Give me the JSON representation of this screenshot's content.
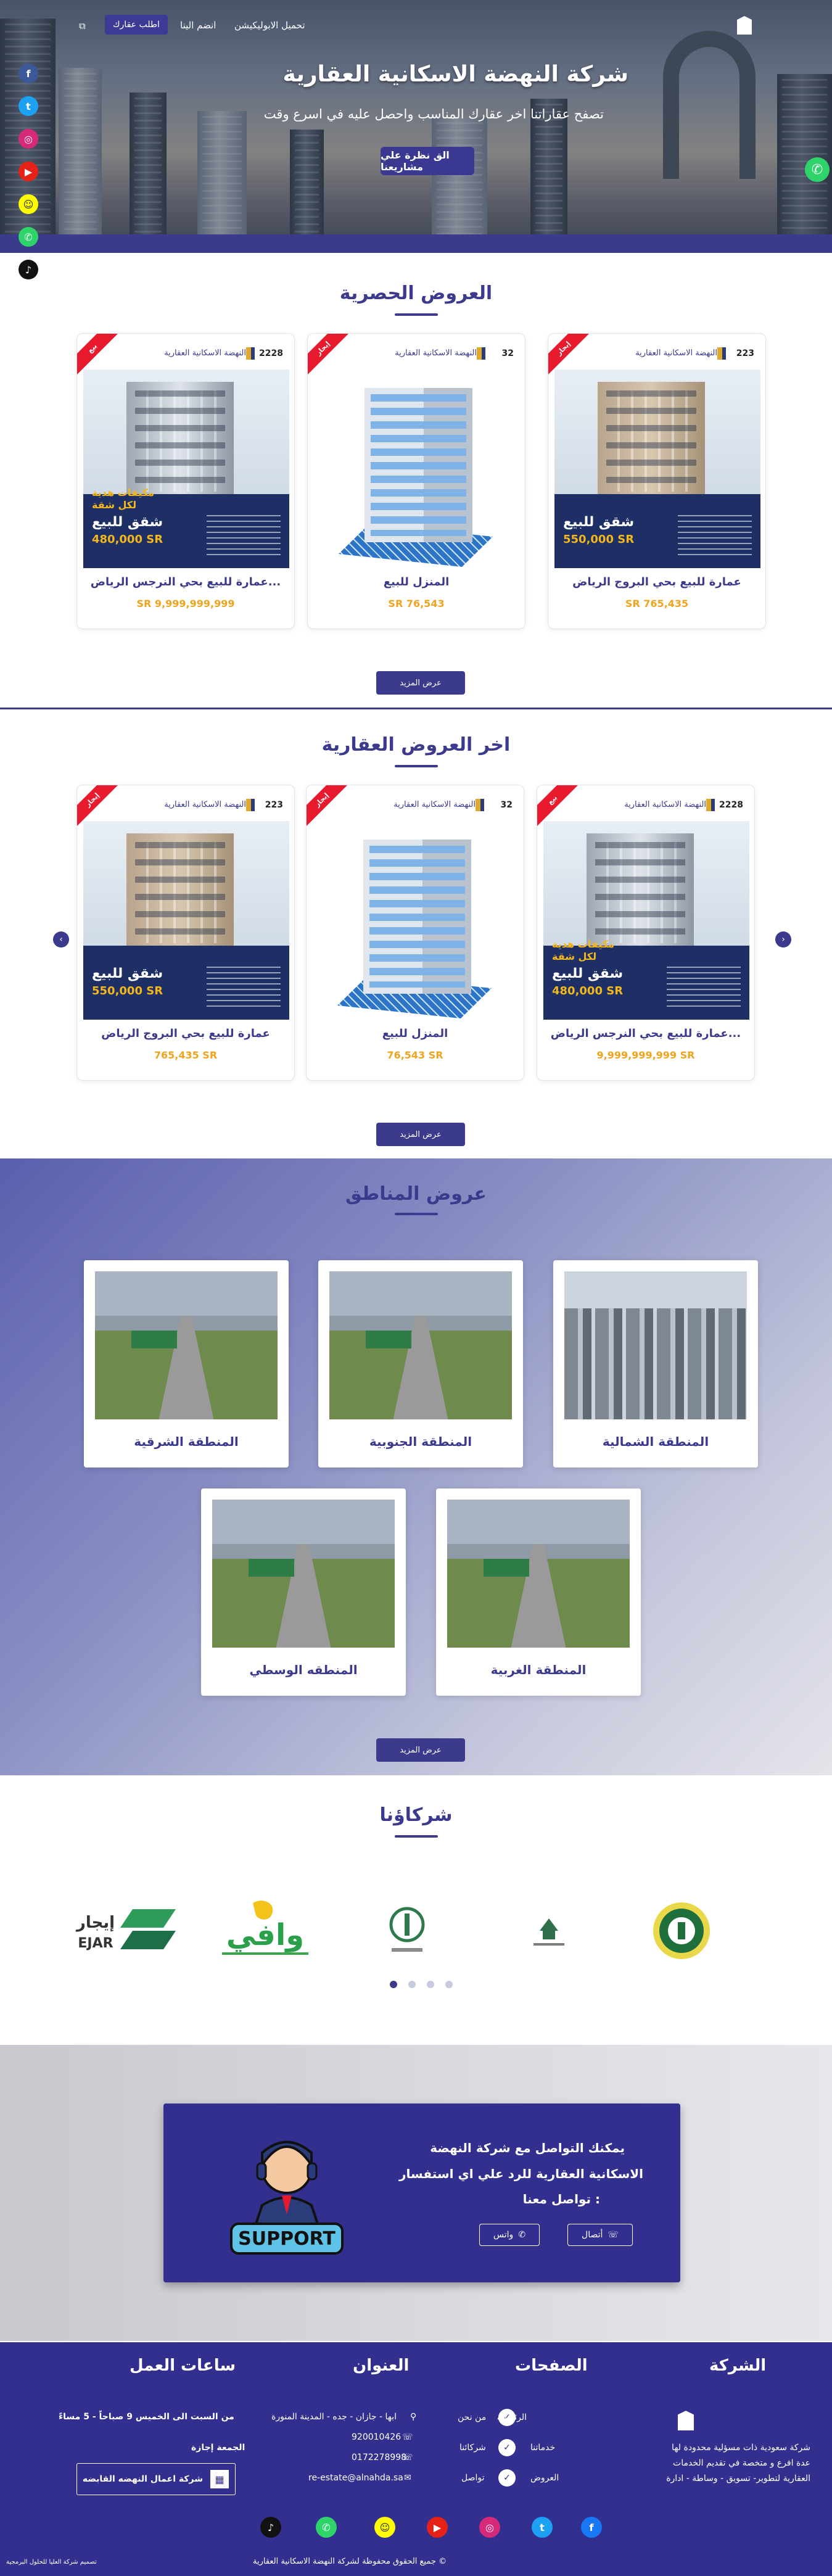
{
  "nav": {
    "download_app": "تحميل الابوليكيشن",
    "join_us": "انضم الينا",
    "request_property": "اطلب عقارك"
  },
  "hero": {
    "title": "شركة النهضة الاسكانية العقارية",
    "subtitle": "تصفح عقاراتنا اخر عقارك المناسب واحصل عليه في اسرع وقت",
    "cta": "الق نظرة علي مشاريعنا"
  },
  "exclusive": {
    "title": "العروض الحصرية",
    "more": "عرض المزيد",
    "cards": [
      {
        "num": "223",
        "brand": "النهضة الاسكانية العقارية",
        "ribbon": "إيجار",
        "poster_title": "شقق للبيع",
        "poster_price": "550,000 SR",
        "poster_gift": "",
        "title": "عمارة للبيع بحي البروج الرياض",
        "price": "SR 765,435"
      },
      {
        "num": "32",
        "brand": "النهضة الاسكانية العقارية",
        "ribbon": "إيجار",
        "poster_title": "",
        "poster_price": "",
        "poster_gift": "",
        "title": "المنزل للبيع",
        "price": "SR 76,543"
      },
      {
        "num": "2228",
        "brand": "النهضة الاسكانية العقارية",
        "ribbon": "بيع",
        "poster_title": "شقق للبيع",
        "poster_price": "480,000 SR",
        "poster_gift": "مكيفات هدية\nلكل شقة",
        "title": "عمارة للبيع بحي النرجس الرياض...",
        "price": "SR 9,999,999,999"
      }
    ]
  },
  "latest": {
    "title": "اخر العروض العقارية",
    "more": "عرض المزيد",
    "cards": [
      {
        "num": "2228",
        "brand": "النهضة الاسكانية العقارية",
        "ribbon": "بيع",
        "poster_title": "شقق للبيع",
        "poster_price": "480,000 SR",
        "poster_gift": "مكيفات هدية\nلكل شقة",
        "title": "عمارة للبيع بحي النرجس الرياض...",
        "price": "9,999,999,999 SR"
      },
      {
        "num": "32",
        "brand": "النهضة الاسكانية العقارية",
        "ribbon": "إيجار",
        "poster_title": "",
        "poster_price": "",
        "poster_gift": "",
        "title": "المنزل للبيع",
        "price": "76,543 SR"
      },
      {
        "num": "223",
        "brand": "النهضة الاسكانية العقارية",
        "ribbon": "إيجار",
        "poster_title": "شقق للبيع",
        "poster_price": "550,000 SR",
        "poster_gift": "",
        "title": "عمارة للبيع بحي البروج الرياض",
        "price": "765,435 SR"
      }
    ]
  },
  "regions": {
    "title": "عروض المناطق",
    "more": "عرض المزيد",
    "items": [
      "المنطقة الشمالية",
      "المنطقة الجنوبية",
      "المنطقة الشرقية",
      "المنطقة الغربية",
      "المنطقه الوسطي"
    ]
  },
  "partners": {
    "title": "شركاؤنا",
    "logos": [
      "إيجار EJAR",
      "وافي",
      "وزارة القضاء",
      "وزارة الإسكان",
      "شعار حكومي"
    ]
  },
  "contact": {
    "line1": "يمكنك التواصل مع شركة النهضة",
    "line2": "الاسكانية العقارية للرد علي اي استفسار",
    "line3": "تواصل معنا :",
    "call": "أتصال",
    "whatsapp": "واتس",
    "support": "SUPPORT"
  },
  "footer": {
    "company_title": "الشركة",
    "company_text_1": "شركة سعودية ذات مسؤلية محدودة لها",
    "company_text_2": "عدة افرع و متخصة في تقديم الخدمات",
    "company_text_3": "العقارية لتطوير- تسويق - وساطة - ادارة",
    "pages_title": "الصفحات",
    "pages": [
      "الرئيسية",
      "من نحن",
      "خدماتنا",
      "شركائنا",
      "العروض",
      "تواصل"
    ],
    "address_title": "العنوان",
    "address": "ابها - جازان - جده - المدينة المنورة",
    "phone1": "920010426",
    "phone2": "0172278998",
    "email": "re-estate@alnahda.sa",
    "hours_title": "ساعات العمل",
    "hours": "من السبت الى الخميس 9 صباحاً - 5 مساءً",
    "friday": "الجمعة إجازة",
    "group_btn": "شركة اعمال النهضه القابضه",
    "copyright": "جميع الحقوق محفوظة لشركة النهضة الاسكانية العقارية ©",
    "design": "تصميم شركة العليا للحلول البرمجية"
  },
  "colors": {
    "primary": "#3b3a8c",
    "accent": "#f0a41d",
    "ribbon": "#e81a2d",
    "whatsapp": "#2ed36a"
  }
}
